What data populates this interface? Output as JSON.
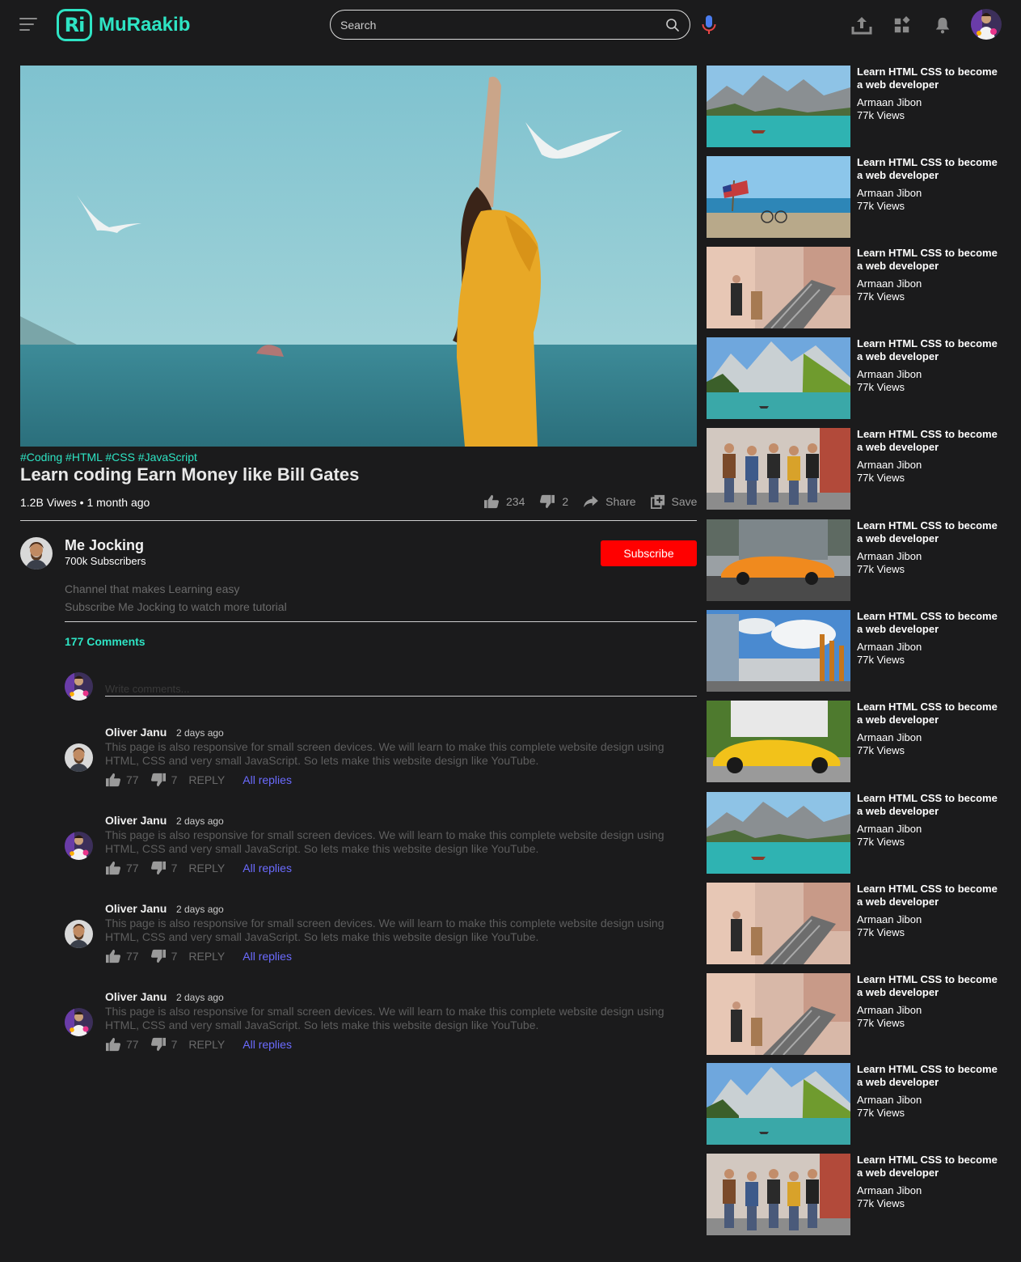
{
  "header": {
    "logo_mark": "Ri",
    "logo_text": "MuRaakib",
    "search_placeholder": "Search"
  },
  "video": {
    "tags": [
      "#Coding",
      "#HTML",
      "#CSS",
      "#JavaScript"
    ],
    "title": "Learn coding Earn Money like Bill Gates",
    "meta": "1.2B Viwes • 1 month ago",
    "likes": "234",
    "dislikes": "2",
    "share_label": "Share",
    "save_label": "Save"
  },
  "channel": {
    "name": "Me Jocking",
    "subscribers": "700k Subscribers",
    "subscribe_label": "Subscribe",
    "desc_line1": "Channel that makes Learning easy",
    "desc_line2": "Subscribe Me Jocking to watch more tutorial"
  },
  "comments": {
    "count_label": "177 Comments",
    "write_placeholder": "Write comments...",
    "items": [
      {
        "author": "Oliver Janu",
        "time": "2 days ago",
        "text": "This page is also responsive for small screen devices. We will learn to make this complete website design using HTML, CSS and very small JavaScript. So lets make this website design like YouTube.",
        "likes": "77",
        "dislikes": "7",
        "reply_label": "REPLY",
        "all_replies_label": "All replies",
        "avatar": "man"
      },
      {
        "author": "Oliver Janu",
        "time": "2 days ago",
        "text": "This page is also responsive for small screen devices. We will learn to make this complete website design using HTML, CSS and very small JavaScript. So lets make this website design like YouTube.",
        "likes": "77",
        "dislikes": "7",
        "reply_label": "REPLY",
        "all_replies_label": "All replies",
        "avatar": "colorful"
      },
      {
        "author": "Oliver Janu",
        "time": "2 days ago",
        "text": "This page is also responsive for small screen devices. We will learn to make this complete website design using HTML, CSS and very small JavaScript. So lets make this website design like YouTube.",
        "likes": "77",
        "dislikes": "7",
        "reply_label": "REPLY",
        "all_replies_label": "All replies",
        "avatar": "man"
      },
      {
        "author": "Oliver Janu",
        "time": "2 days ago",
        "text": "This page is also responsive for small screen devices. We will learn to make this complete website design using HTML, CSS and very small JavaScript. So lets make this website design like YouTube.",
        "likes": "77",
        "dislikes": "7",
        "reply_label": "REPLY",
        "all_replies_label": "All replies",
        "avatar": "colorful"
      }
    ]
  },
  "sidebar": {
    "items": [
      {
        "title": "Learn HTML CSS to become a web developer",
        "channel": "Armaan Jibon",
        "views": "77k Views",
        "thumb": "lake"
      },
      {
        "title": "Learn HTML CSS to become a web developer",
        "channel": "Armaan Jibon",
        "views": "77k Views",
        "thumb": "beach"
      },
      {
        "title": "Learn HTML CSS to become a web developer",
        "channel": "Armaan Jibon",
        "views": "77k Views",
        "thumb": "street"
      },
      {
        "title": "Learn HTML CSS to become a web developer",
        "channel": "Armaan Jibon",
        "views": "77k Views",
        "thumb": "mountains"
      },
      {
        "title": "Learn HTML CSS to become a web developer",
        "channel": "Armaan Jibon",
        "views": "77k Views",
        "thumb": "people"
      },
      {
        "title": "Learn HTML CSS to become a web developer",
        "channel": "Armaan Jibon",
        "views": "77k Views",
        "thumb": "orange-car"
      },
      {
        "title": "Learn HTML CSS to become a web developer",
        "channel": "Armaan Jibon",
        "views": "77k Views",
        "thumb": "building"
      },
      {
        "title": "Learn HTML CSS to become a web developer",
        "channel": "Armaan Jibon",
        "views": "77k Views",
        "thumb": "yellow-car"
      },
      {
        "title": "Learn HTML CSS to become a web developer",
        "channel": "Armaan Jibon",
        "views": "77k Views",
        "thumb": "lake"
      },
      {
        "title": "Learn HTML CSS to become a web developer",
        "channel": "Armaan Jibon",
        "views": "77k Views",
        "thumb": "street"
      },
      {
        "title": "Learn HTML CSS to become a web developer",
        "channel": "Armaan Jibon",
        "views": "77k Views",
        "thumb": "street"
      },
      {
        "title": "Learn HTML CSS to become a web developer",
        "channel": "Armaan Jibon",
        "views": "77k Views",
        "thumb": "mountains"
      },
      {
        "title": "Learn HTML CSS to become a web developer",
        "channel": "Armaan Jibon",
        "views": "77k Views",
        "thumb": "people"
      }
    ]
  },
  "colors": {
    "background": "#1b1b1c",
    "accent": "#2ee4c4",
    "subscribe": "#ff0000",
    "link": "#6b6bff"
  }
}
